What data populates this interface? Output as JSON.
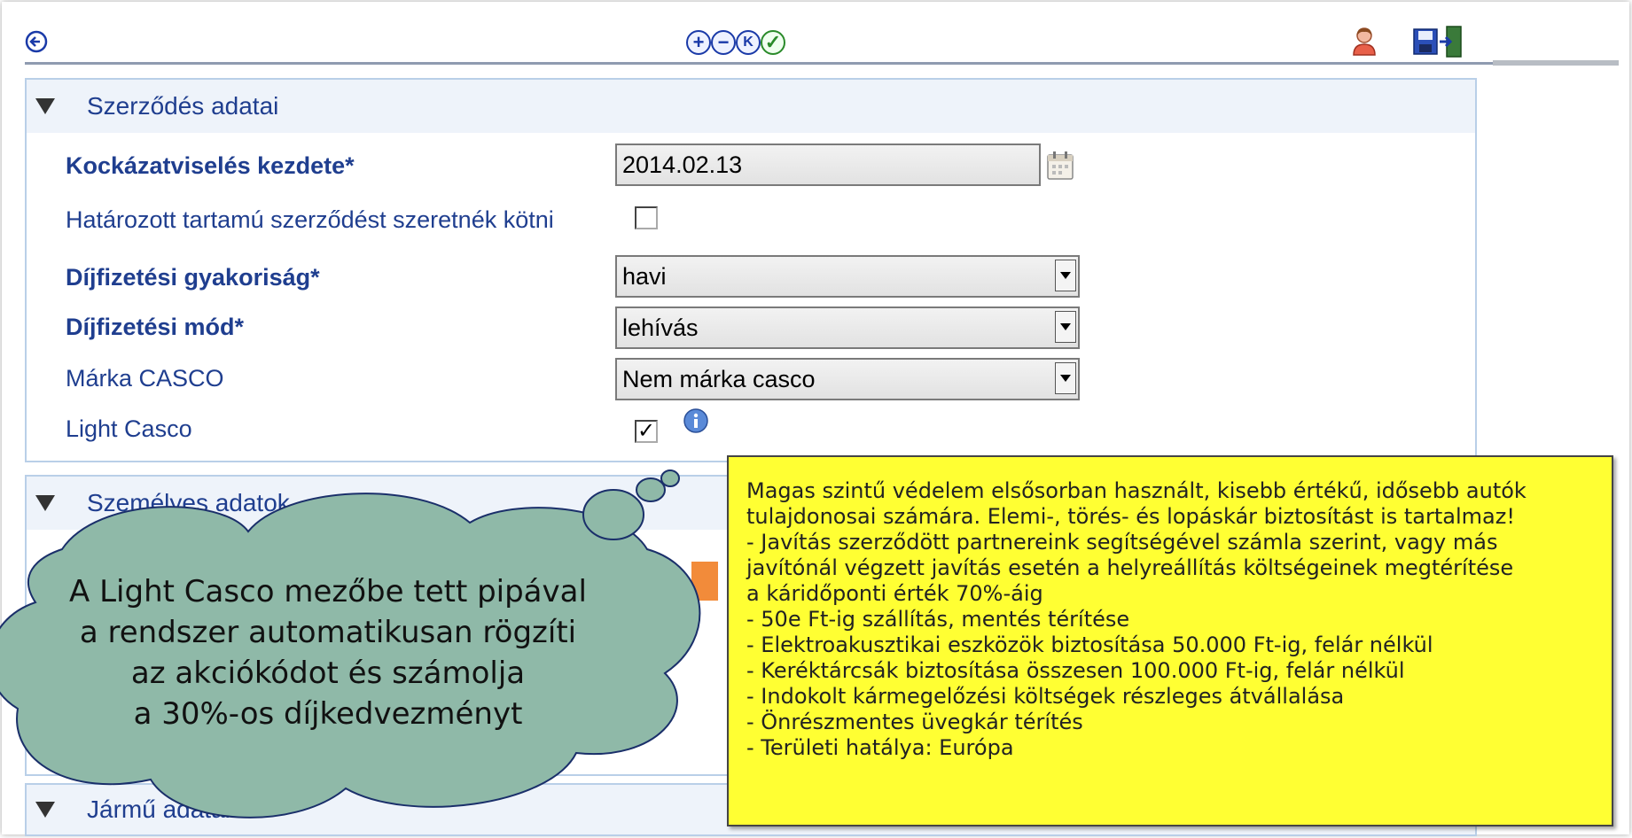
{
  "toolbar": {
    "back_icon": "back-arrow-icon",
    "add_symbol": "+",
    "remove_symbol": "−",
    "k_symbol": "K",
    "ok_symbol": "✓",
    "user_icon": "user-icon",
    "save_icon": "save-icon",
    "exit_icon": "exit-icon"
  },
  "contract": {
    "title": "Szerződés adatai",
    "start_label": "Kockázatviselés kezdete*",
    "start_value": "2014.02.13",
    "fixed_term_label": "Határozott tartamú szerződést szeretnék kötni",
    "fixed_term_checked": false,
    "frequency_label": "Díjfizetési gyakoriság*",
    "frequency_value": "havi",
    "payment_label": "Díjfizetési mód*",
    "payment_value": "lehívás",
    "brand_label": "Márka CASCO",
    "brand_value": "Nem márka casco",
    "light_label": "Light Casco",
    "light_checked_mark": "✓"
  },
  "personal": {
    "title": "Személyes adatok"
  },
  "vehicle": {
    "title": "Jármű adatai"
  },
  "tooltip": {
    "lines": [
      "Magas szintű védelem elsősorban használt, kisebb értékű, idősebb autók",
      "tulajdonosai számára. Elemi-, törés- és lopáskár biztosítást is tartalmaz!",
      "- Javítás szerződött partnereink segítségével számla szerint, vagy más",
      "javítónál végzett javítás esetén a helyreállítás költségeinek megtérítése",
      "a káridőponti érték 70%-áig",
      "- 50e Ft-ig szállítás, mentés térítése",
      "- Elektroakusztikai eszközök biztosítása 50.000 Ft-ig, felár nélkül",
      "- Keréktárcsák biztosítása összesen 100.000 Ft-ig, felár nélkül",
      "- Indokolt kármegelőzési költségek részleges átvállalása",
      "- Önrészmentes üvegkár térítés",
      "- Területi hatálya: Európa"
    ]
  },
  "callout": {
    "lines": [
      "A Light Casco mezőbe tett pipával",
      "a rendszer automatikusan rögzíti",
      "az akciókódot és számolja",
      "a 30%-os díjkedvezményt"
    ]
  },
  "colors": {
    "tooltip_bg": "#ffff33",
    "cloud_fill": "#8fb9a8",
    "label_blue": "#1f3e8f"
  }
}
